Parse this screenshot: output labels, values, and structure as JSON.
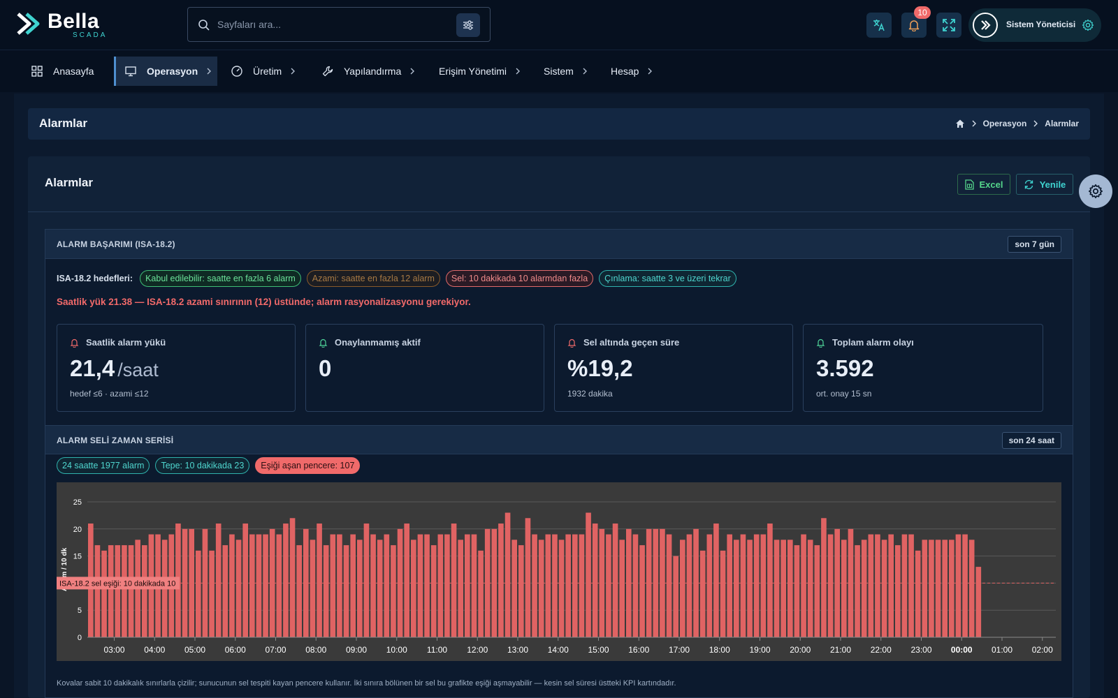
{
  "app": {
    "logo_text": "Bella",
    "logo_sub": "SCADA"
  },
  "search": {
    "placeholder": "Sayfaları ara..."
  },
  "header": {
    "notifications_count": "10",
    "user_name": "Sistem Yöneticisi"
  },
  "nav": {
    "items": [
      {
        "label": "Anasayfa",
        "icon": "grid-icon"
      },
      {
        "label": "Operasyon",
        "icon": "monitor-icon"
      },
      {
        "label": "Üretim",
        "icon": "gauge-icon"
      },
      {
        "label": "Yapılandırma",
        "icon": "wrench-icon"
      },
      {
        "label": "Erişim Yönetimi",
        "icon": ""
      },
      {
        "label": "Sistem",
        "icon": ""
      },
      {
        "label": "Hesap",
        "icon": ""
      }
    ]
  },
  "page": {
    "title": "Alarmlar",
    "breadcrumb": [
      "Operasyon",
      "Alarmlar"
    ]
  },
  "card": {
    "title": "Alarmlar",
    "excel_label": "Excel",
    "refresh_label": "Yenile"
  },
  "performance": {
    "section_title": "ALARM BAŞARIMI (ISA-18.2)",
    "range": "son 7 gün",
    "targets_label": "ISA-18.2 hedefleri:",
    "targets": [
      "Kabul edilebilir: saatte en fazla 6 alarm",
      "Azami: saatte en fazla 12 alarm",
      "Sel: 10 dakikada 10 alarmdan fazla",
      "Çınlama: saatte 3 ve üzeri tekrar"
    ],
    "warning": "Saatlik yük 21.38 — ISA-18.2 azami sınırının (12) üstünde; alarm rasyonalizasyonu gerekiyor.",
    "kpis": [
      {
        "title": "Saatlik alarm yükü",
        "value": "21,4",
        "unit": "/saat",
        "sub": "hedef ≤6 · azami ≤12",
        "icon_color": "#f06a6a"
      },
      {
        "title": "Onaylanmamış aktif",
        "value": "0",
        "unit": "",
        "sub": "",
        "icon_color": "#4fd69a"
      },
      {
        "title": "Sel altında geçen süre",
        "value": "%19,2",
        "unit": "",
        "sub": "1932 dakika",
        "icon_color": "#f06a6a"
      },
      {
        "title": "Toplam alarm olayı",
        "value": "3.592",
        "unit": "",
        "sub": "ort. onay 15 sn",
        "icon_color": "#4fd69a"
      }
    ]
  },
  "flood": {
    "section_title": "ALARM SELİ ZAMAN SERİSİ",
    "range": "son 24 saat",
    "summary": [
      "24 saatte 1977 alarm",
      "Tepe: 10 dakikada 23",
      "Eşiği aşan pencere: 107"
    ],
    "footnote": "Kovalar sabit 10 dakikalık sınırlarla çizilir; sunucunun sel tespiti kayan pencere kullanır. İki sınıra bölünen bir sel bu grafikte eşiği aşmayabilir — kesin sel süresi üstteki KPI kartındadır."
  },
  "chart_data": {
    "type": "bar",
    "ylabel": "Alarm / 10 dk",
    "ylim": [
      0,
      25
    ],
    "yticks": [
      0,
      5,
      10,
      15,
      20,
      25
    ],
    "xticks": [
      "03:00",
      "04:00",
      "05:00",
      "06:00",
      "07:00",
      "08:00",
      "09:00",
      "10:00",
      "11:00",
      "12:00",
      "13:00",
      "14:00",
      "15:00",
      "16:00",
      "17:00",
      "18:00",
      "19:00",
      "20:00",
      "21:00",
      "22:00",
      "23:00",
      "00:00",
      "01:00",
      "02:00"
    ],
    "first_bucket": "02:20",
    "bucket_minutes": 10,
    "threshold": 10,
    "threshold_label": "ISA-18.2 sel eşiği: 10 dakikada 10",
    "bar_color": "#e06363",
    "values": [
      21,
      17,
      16,
      17,
      17,
      17,
      17,
      18,
      17,
      19,
      19,
      18,
      19,
      21,
      20,
      20,
      16,
      20,
      16,
      21,
      17,
      19,
      18,
      21,
      19,
      19,
      19,
      20,
      19,
      21,
      22,
      17,
      20,
      18,
      21,
      17,
      19,
      19,
      17,
      19,
      18,
      21,
      19,
      18,
      19,
      17,
      20,
      21,
      18,
      19,
      19,
      17,
      19,
      19,
      21,
      18,
      19,
      19,
      16,
      20,
      20,
      21,
      23,
      18,
      17,
      22,
      19,
      18,
      19,
      19,
      18,
      19,
      19,
      19,
      23,
      21,
      20,
      19,
      21,
      18,
      20,
      19,
      17,
      20,
      20,
      20,
      19,
      15,
      18,
      19,
      20,
      16,
      19,
      21,
      16,
      19,
      18,
      19,
      18,
      19,
      19,
      21,
      18,
      18,
      18,
      17,
      19,
      18,
      17,
      22,
      19,
      20,
      18,
      20,
      17,
      18,
      19,
      19,
      18,
      19,
      17,
      19,
      19,
      16,
      18,
      18,
      18,
      18,
      18,
      19,
      19,
      18,
      13
    ]
  }
}
